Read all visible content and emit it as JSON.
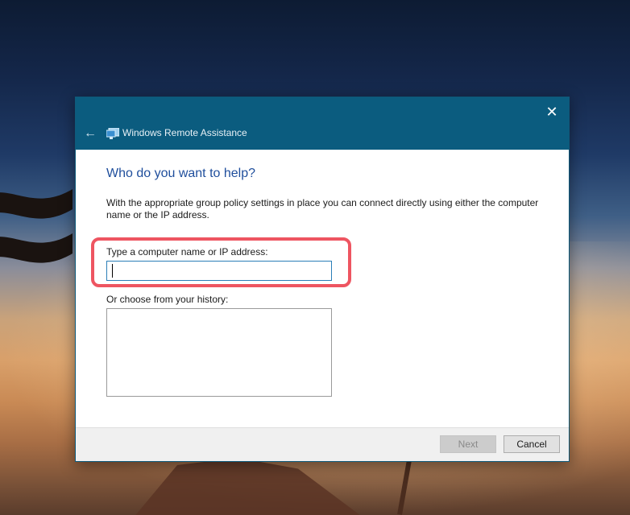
{
  "window": {
    "title": "Windows Remote Assistance",
    "close_glyph": "✕",
    "back_glyph": "←",
    "icons": {
      "close": "close-icon",
      "back": "back-arrow-icon",
      "app": "remote-assistance-icon"
    }
  },
  "page": {
    "heading": "Who do you want to help?",
    "description": "With the appropriate group policy settings in place you can connect directly using either the computer name or the IP address."
  },
  "computer_field": {
    "label": "Type a computer name or IP address:",
    "value": "",
    "highlight_color": "#ee5561"
  },
  "history": {
    "label": "Or choose from your history:",
    "items": []
  },
  "footer": {
    "next_label": "Next",
    "cancel_label": "Cancel"
  },
  "colors": {
    "titlebar": "#0b5c7f",
    "heading": "#1f4e9c"
  }
}
